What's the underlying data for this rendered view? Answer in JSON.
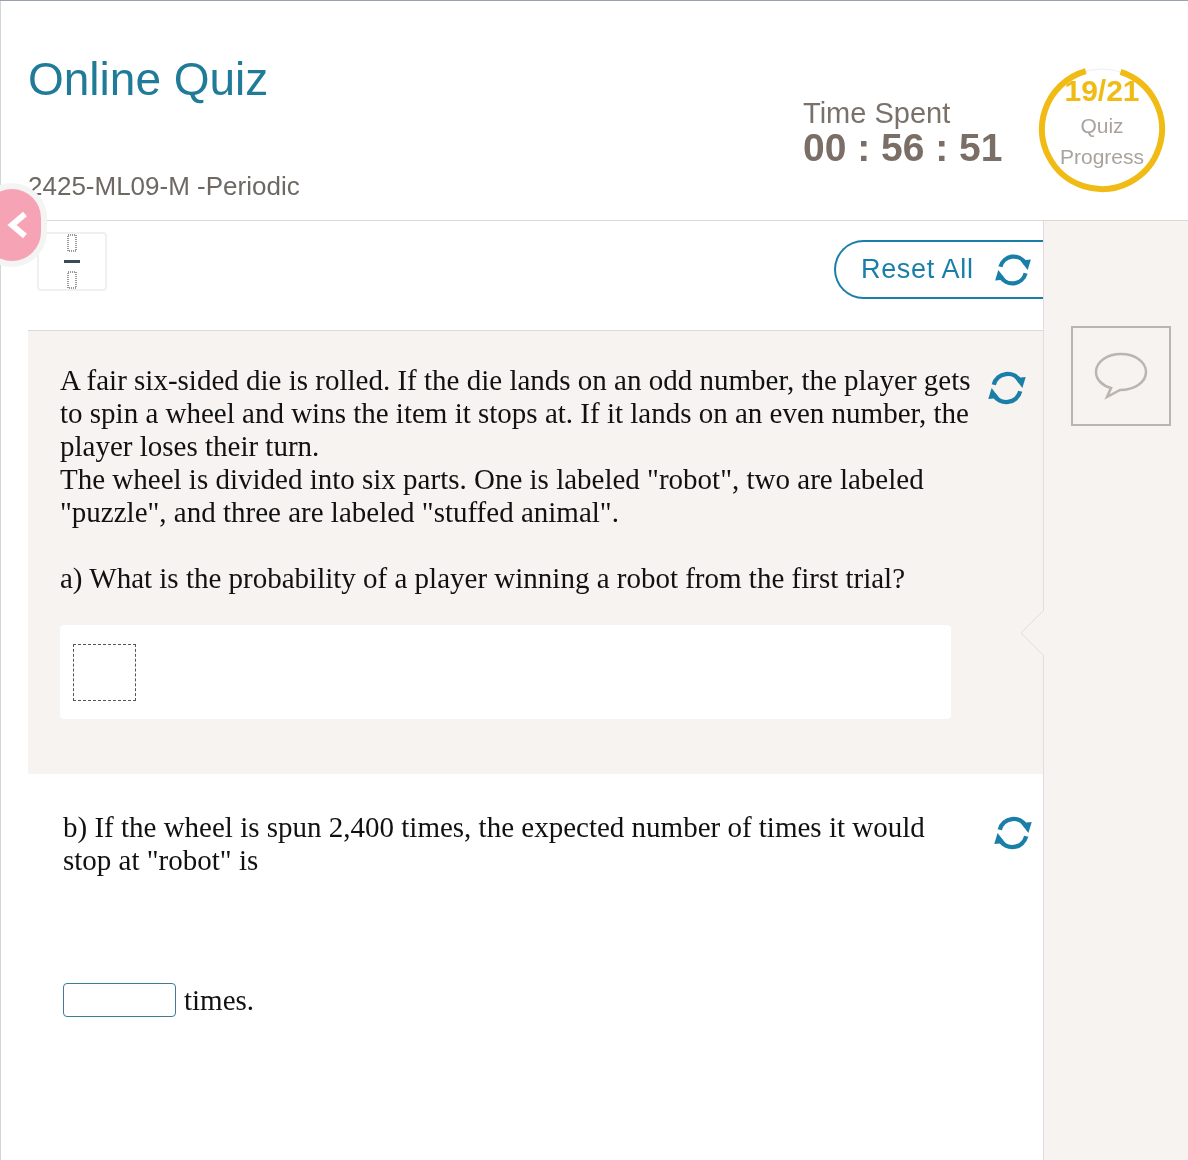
{
  "header": {
    "title": "Online Quiz",
    "subtitle": "2425-ML09-M -Periodic",
    "time_label": "Time Spent",
    "time_value": "00 : 56 : 51"
  },
  "progress": {
    "count": "19/21",
    "label_1": "Quiz",
    "label_2": "Progress",
    "level": 0.905
  },
  "toolbar": {
    "reset_label": "Reset All"
  },
  "question": {
    "paragraphs": [
      "A fair six-sided die is rolled. If the die lands on an odd number, the player gets to spin a wheel and wins the item it stops at. If it lands on an even number, the player loses their turn.",
      "The wheel is divided into six parts. One is labeled \"robot\", two are labeled \"puzzle\", and three are labeled \"stuffed animal\"."
    ],
    "part_a": "a) What is the probability of a player winning a robot from the first trial?",
    "part_b": "b) If the wheel is spun 2,400 times, the expected number of times it would stop at \"robot\" is",
    "unit": "times."
  }
}
